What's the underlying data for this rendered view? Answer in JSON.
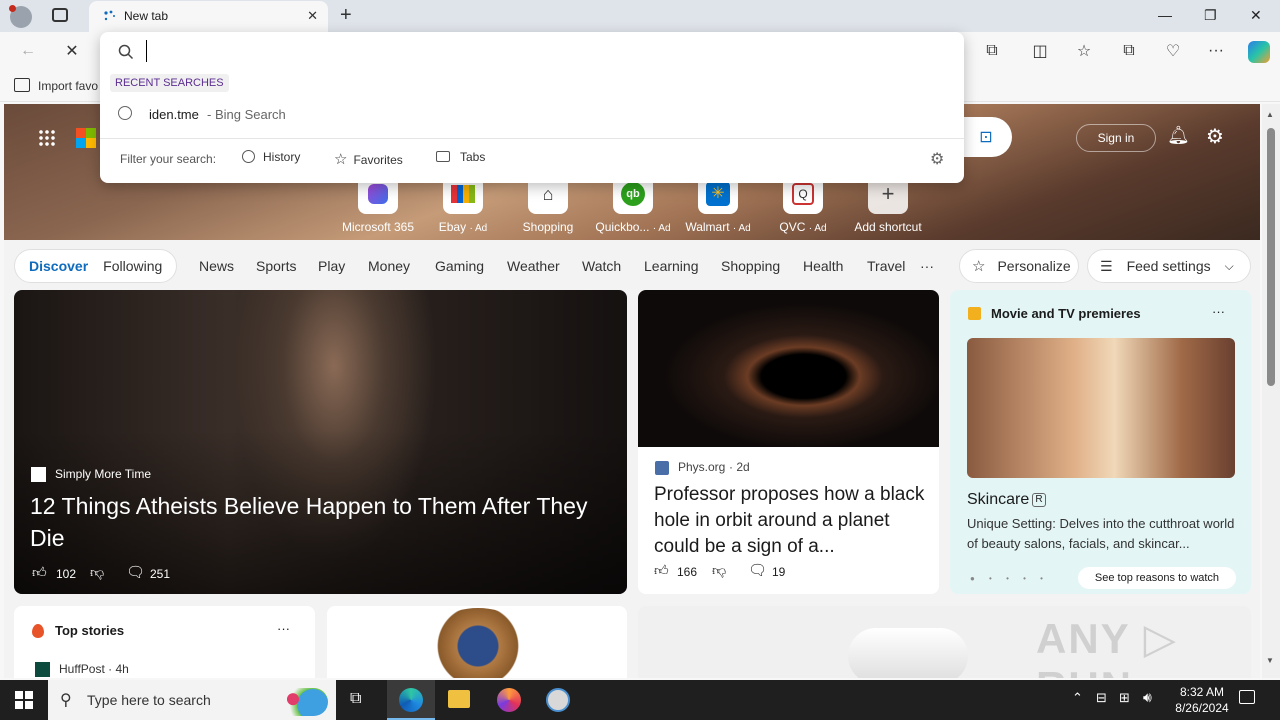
{
  "browser": {
    "tab_title": "New tab",
    "import_favorites": "Import favo",
    "omnibox": {
      "value": "",
      "recent_header": "RECENT SEARCHES",
      "recent_items": [
        {
          "text": "iden.tme",
          "suffix": "- Bing Search"
        }
      ],
      "filter_label": "Filter your search:",
      "filters": [
        "History",
        "Favorites",
        "Tabs"
      ]
    }
  },
  "newtab": {
    "sign_in": "Sign in",
    "shortcuts": [
      {
        "label": "Microsoft 365",
        "ad": ""
      },
      {
        "label": "Ebay",
        "ad": "· Ad"
      },
      {
        "label": "Shopping",
        "ad": ""
      },
      {
        "label": "Quickbo...",
        "ad": "· Ad"
      },
      {
        "label": "Walmart",
        "ad": "· Ad"
      },
      {
        "label": "QVC",
        "ad": "· Ad"
      },
      {
        "label": "Add shortcut",
        "ad": ""
      }
    ],
    "nav": {
      "discover": "Discover",
      "following": "Following",
      "links": [
        "News",
        "Sports",
        "Play",
        "Money",
        "Gaming",
        "Weather",
        "Watch",
        "Learning",
        "Shopping",
        "Health",
        "Travel"
      ],
      "more": "···",
      "personalize": "Personalize",
      "feed_settings": "Feed settings"
    },
    "main_card": {
      "source": "Simply More Time",
      "headline": "12 Things Atheists Believe Happen to Them After They Die",
      "likes": "102",
      "comments": "251"
    },
    "second_card": {
      "source": "Phys.org",
      "age": "· 2d",
      "headline": "Professor proposes how a black hole in orbit around a planet could be a sign of a...",
      "likes": "166",
      "comments": "19"
    },
    "movie_card": {
      "header": "Movie and TV premieres",
      "title": "Skincare",
      "rating": "R",
      "desc": "Unique Setting: Delves into the cutthroat world of beauty salons, facials, and skincar...",
      "cta": "See top reasons to watch"
    },
    "top_stories": {
      "header": "Top stories",
      "first_source": "HuffPost · 4h"
    },
    "more_icon": "···"
  },
  "taskbar": {
    "search_placeholder": "Type here to search",
    "time": "8:32 AM",
    "date": "8/26/2024"
  },
  "colors": {
    "accent": "#0f6cbd",
    "purple_label": "#5c2e91"
  }
}
